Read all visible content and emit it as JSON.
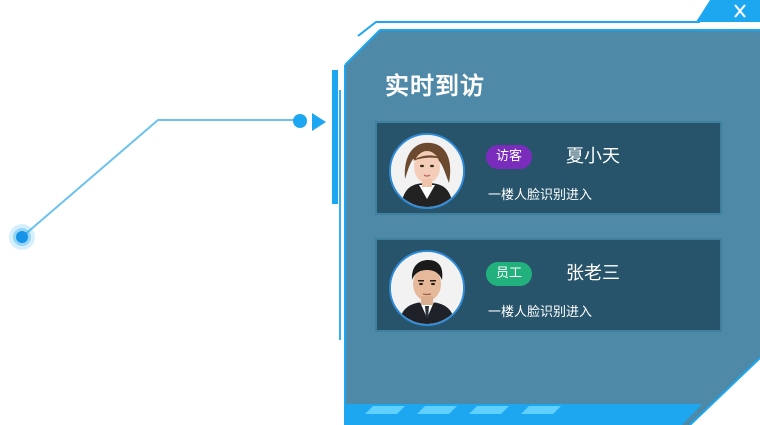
{
  "panel": {
    "title": "实时到访"
  },
  "visits": [
    {
      "badge": "访客",
      "badge_color": "#7a2dbd",
      "name": "夏小天",
      "detail": "一楼人脸识别进入",
      "avatar": "female-portrait"
    },
    {
      "badge": "员工",
      "badge_color": "#22b07c",
      "name": "张老三",
      "detail": "一楼人脸识别进入",
      "avatar": "male-portrait"
    }
  ],
  "colors": {
    "panel_fill": "#4e8aa8",
    "frame_accent": "#1da7f0",
    "connector": "#6cc2ee",
    "card_fill": "#27546a"
  },
  "icons": {
    "close": "close-icon",
    "arrow": "arrow-right-icon"
  }
}
